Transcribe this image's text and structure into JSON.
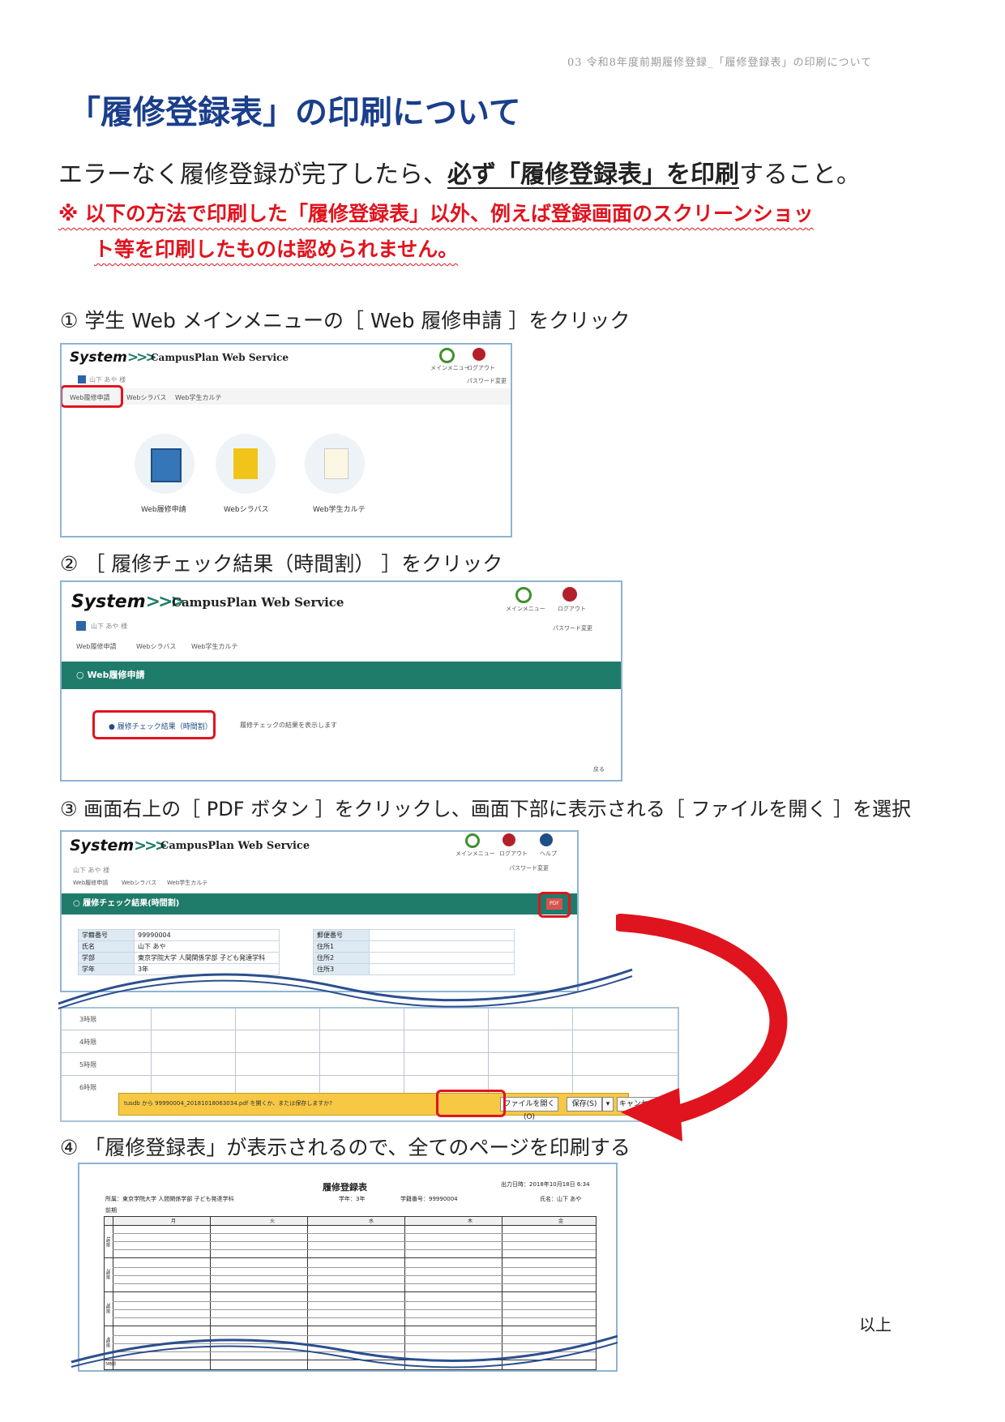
{
  "header_note": "03 令和8年度前期履修登録_「履修登録表」の印刷について",
  "title": "「履修登録表」の印刷について",
  "lead": {
    "before": "エラーなく履修登録が完了したら、",
    "emphasis": "必ず「履修登録表」を印刷",
    "after": "すること。"
  },
  "warning": {
    "line1": "※ 以下の方法で印刷した「履修登録表」以外、例えば登録画面のスクリーンショッ",
    "line2": "ト等を印刷したものは認められません。"
  },
  "steps": [
    "① 学生 Web メインメニューの［ Web 履修申請 ］をクリック",
    "② ［ 履修チェック結果（時間割） ］をクリック",
    "③ 画面右上の［ PDF ボタン ］をクリックし、画面下部に表示される［ ファイルを開く ］を選択",
    "④ 「履修登録表」が表示されるので、全てのページを印刷する"
  ],
  "app": {
    "logo": "System",
    "service": "CampusPlan Web Service",
    "main_menu": "メインメニュー",
    "logout": "ログアウト",
    "help": "ヘルプ",
    "password_change": "パスワード変更",
    "user": "山下 あや 様",
    "nav": [
      "Web履修申請",
      "Webシラバス",
      "Web学生カルテ"
    ],
    "tiles": [
      "Web履修申請",
      "Webシラバス",
      "Web学生カルテ"
    ],
    "section_web": "Web履修申請",
    "check_link": "履修チェック結果（時間割）",
    "check_desc": "履修チェックの結果を表示します",
    "back": "戻る",
    "section_result": "履修チェック結果(時間割)",
    "pdf": "PDF"
  },
  "student_info": {
    "left": [
      {
        "k": "学籍番号",
        "v": "99990004"
      },
      {
        "k": "氏名",
        "v": "山下 あや"
      },
      {
        "k": "学部",
        "v": "東京学院大学 人間関係学部 子ども発達学科"
      },
      {
        "k": "学年",
        "v": "3年"
      }
    ],
    "right": [
      {
        "k": "郵便番号",
        "v": ""
      },
      {
        "k": "住所1",
        "v": ""
      },
      {
        "k": "住所2",
        "v": ""
      },
      {
        "k": "住所3",
        "v": ""
      }
    ]
  },
  "periods": [
    "3時限",
    "4時限",
    "5時限",
    "6時限"
  ],
  "download_bar": {
    "message": "tusdb から 99990004_20181018063034.pdf を開くか、または保存しますか?",
    "open": "ファイルを開く(O)",
    "save": "保存(S)",
    "cancel": "キャンセル(C)"
  },
  "register_doc": {
    "title": "履修登録表",
    "output_date": "出力日時：2018年10月18日 6:34",
    "affiliation": "所属：東京学院大学 人間関係学部 子ども発達学科",
    "grade": "学年：3年",
    "student_no": "学籍番号：99990004",
    "name": "氏名：山下 あや",
    "term": "前期",
    "days": [
      "月",
      "火",
      "水",
      "木",
      "金"
    ],
    "periods": [
      "1時限",
      "2時限",
      "3時限",
      "4時限",
      "5時限"
    ]
  },
  "end_mark": "以上",
  "colors": {
    "title": "#1a3e8c",
    "warning": "#e0141e",
    "teal": "#1f7b6a",
    "highlight": "#e0141e"
  }
}
